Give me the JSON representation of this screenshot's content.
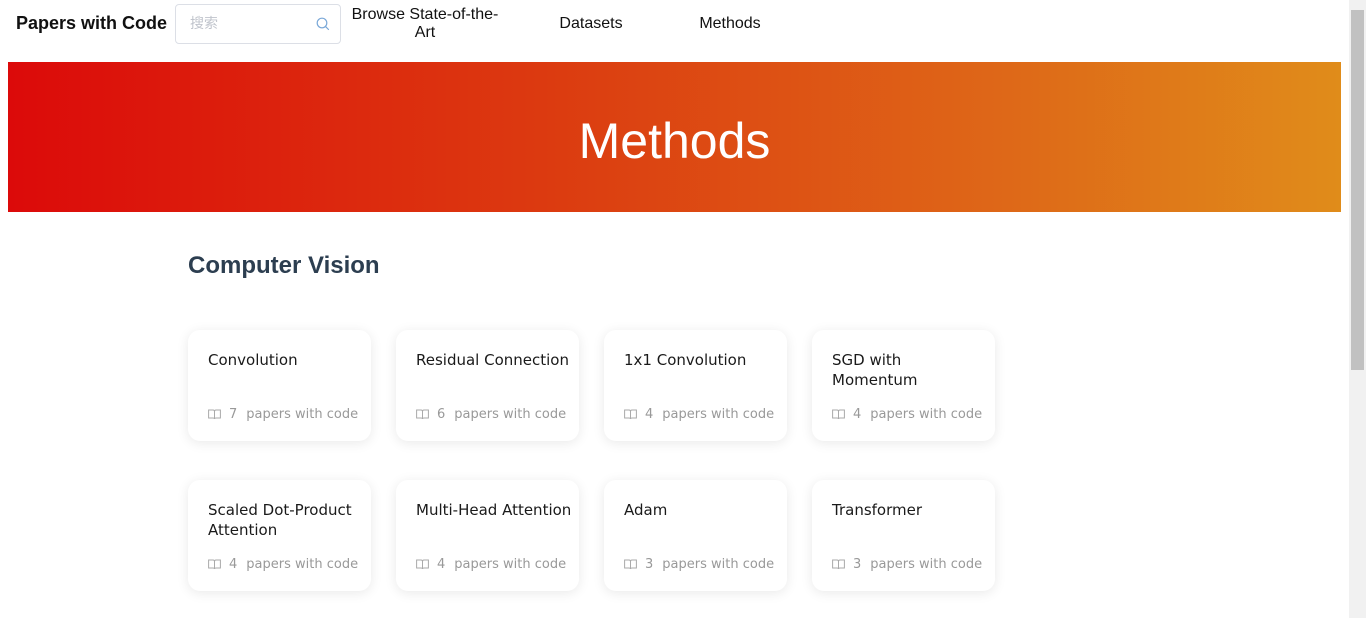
{
  "nav": {
    "brand": "Papers with Code",
    "search_placeholder": "搜索",
    "links": [
      "Browse State-of-the-Art",
      "Datasets",
      "Methods"
    ]
  },
  "hero": {
    "title": "Methods"
  },
  "section": {
    "title": "Computer Vision",
    "cards": [
      {
        "name": "Convolution",
        "count": "7",
        "label": "papers with code"
      },
      {
        "name": "Residual Connection",
        "count": "6",
        "label": "papers with code"
      },
      {
        "name": "1x1 Convolution",
        "count": "4",
        "label": "papers with code"
      },
      {
        "name": "SGD with Momentum",
        "count": "4",
        "label": "papers with code"
      },
      {
        "name": "Scaled Dot-Product Attention",
        "count": "4",
        "label": "papers with code"
      },
      {
        "name": "Multi-Head Attention",
        "count": "4",
        "label": "papers with code"
      },
      {
        "name": "Adam",
        "count": "3",
        "label": "papers with code"
      },
      {
        "name": "Transformer",
        "count": "3",
        "label": "papers with code"
      }
    ]
  },
  "colors": {
    "hero_gradient": [
      "#dc0a0a",
      "#e08c1a"
    ],
    "section_title": "#2c3e50",
    "meta_text": "#999999"
  },
  "icons": {
    "search": "search-icon",
    "papers": "book-icon"
  }
}
